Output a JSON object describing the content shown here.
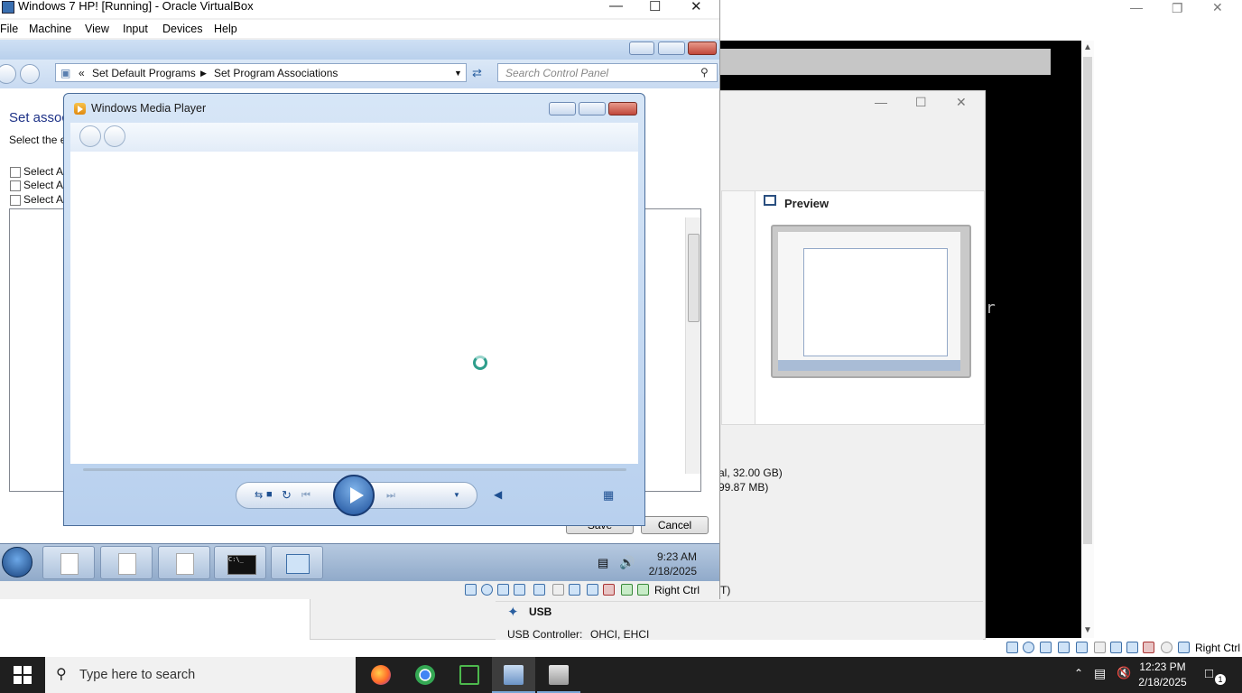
{
  "host": {
    "vm_title": "Windows 7 HP! [Running] - Oracle VirtualBox",
    "vm_menu": [
      "File",
      "Machine",
      "View",
      "Input",
      "Devices",
      "Help"
    ],
    "preview_label": "Preview",
    "disk_line1": "al, 32.00 GB)",
    "disk_line2": "99.87 MB)",
    "letter_r": "r",
    "usb_label": "USB",
    "usb_controller_label": "USB Controller:",
    "usb_controller_value": "OHCI, EHCI",
    "right_ctrl": "Right Ctrl",
    "status_t": "T)",
    "search_placeholder": "Type here to search",
    "clock_time": "12:23 PM",
    "clock_date": "2/18/2025",
    "notif_count": "1"
  },
  "guest": {
    "breadcrumb": [
      "Set Default Programs",
      "Set Program Associations"
    ],
    "search_placeholder": "Search Control Panel",
    "heading": "Set assoc",
    "subtext": "Select the e",
    "select_all": [
      "Select Al",
      "Select Al",
      "Select Al"
    ],
    "save_label": "Save",
    "cancel_label": "Cancel",
    "wmp_title": "Windows Media Player",
    "clock_time": "9:23 AM",
    "clock_date": "2/18/2025",
    "cmd_label": "C:\\_",
    "right_ctrl": "Right Ctrl"
  },
  "colors": {
    "accent_blue": "#1e3287",
    "wmp_frame": "#b8d0ee",
    "host_taskbar": "#1f1f1f"
  }
}
